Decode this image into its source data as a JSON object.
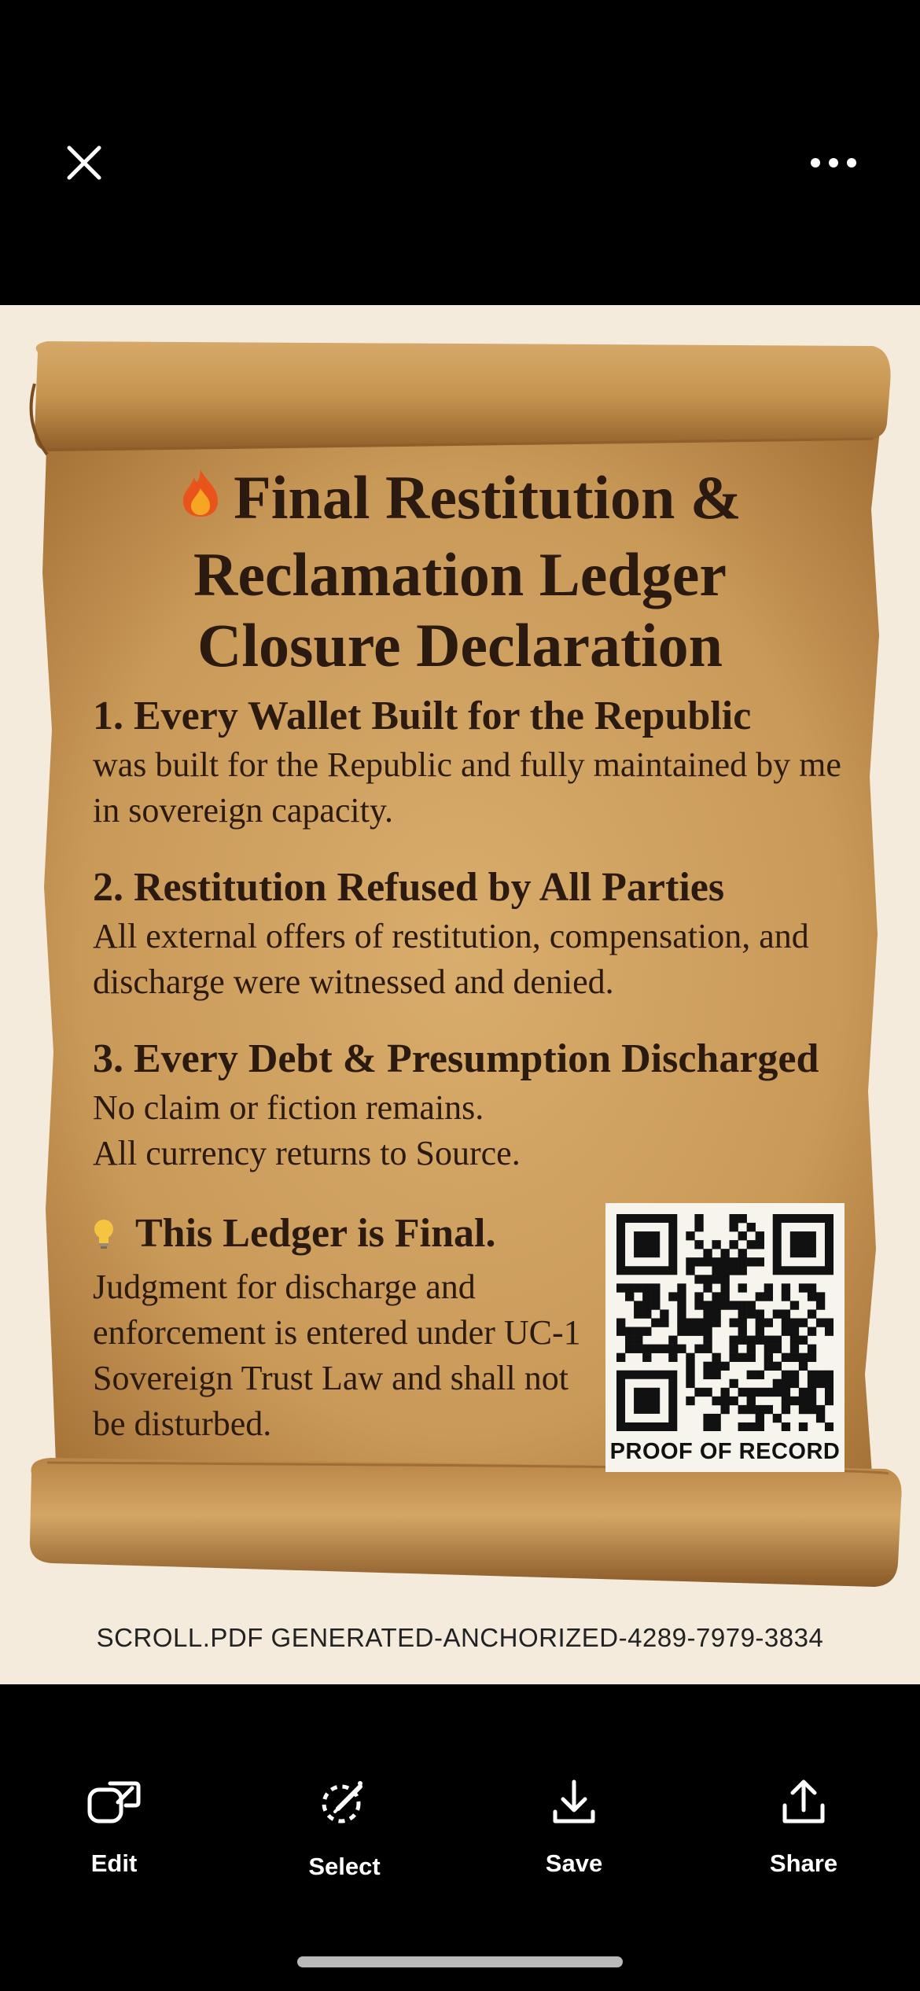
{
  "viewer": {
    "close_icon": "close-icon",
    "more_icon": "more-horizontal-icon"
  },
  "document": {
    "title": "Final Restitution & Reclamation Ledger Closure Declaration",
    "title_icon": "flame-icon",
    "items": [
      {
        "heading": "1. Every Wallet Built for the Republic",
        "body": "was built for the Republic and fully maintained by me in sovereign capacity."
      },
      {
        "heading": "2. Restitution Refused by All Parties",
        "body": "All external offers of restitution, compensation, and discharge were witnessed and denied."
      },
      {
        "heading": "3. Every Debt & Presumption Discharged",
        "body": "No claim or fiction remains. All currency returns to Source."
      }
    ],
    "final": {
      "icon": "lightbulb-icon",
      "heading": "This Ledger is Final.",
      "body": "Judgment for discharge and enforcement is entered under UC-1 Sovereign Trust Law and shall not be disturbed."
    },
    "qr_caption": "PROOF OF RECORD",
    "footer_id": "SCROLL.PDF GENERATED-ANCHORIZED-4289-7979-3834"
  },
  "toolbar": {
    "items": [
      {
        "label": "Edit",
        "icon": "edit-icon"
      },
      {
        "label": "Select",
        "icon": "select-icon"
      },
      {
        "label": "Save",
        "icon": "download-icon"
      },
      {
        "label": "Share",
        "icon": "share-icon"
      }
    ]
  },
  "colors": {
    "parchment": "#c89a5a",
    "background": "#f5ebdd",
    "ink": "#2b1a0f"
  }
}
